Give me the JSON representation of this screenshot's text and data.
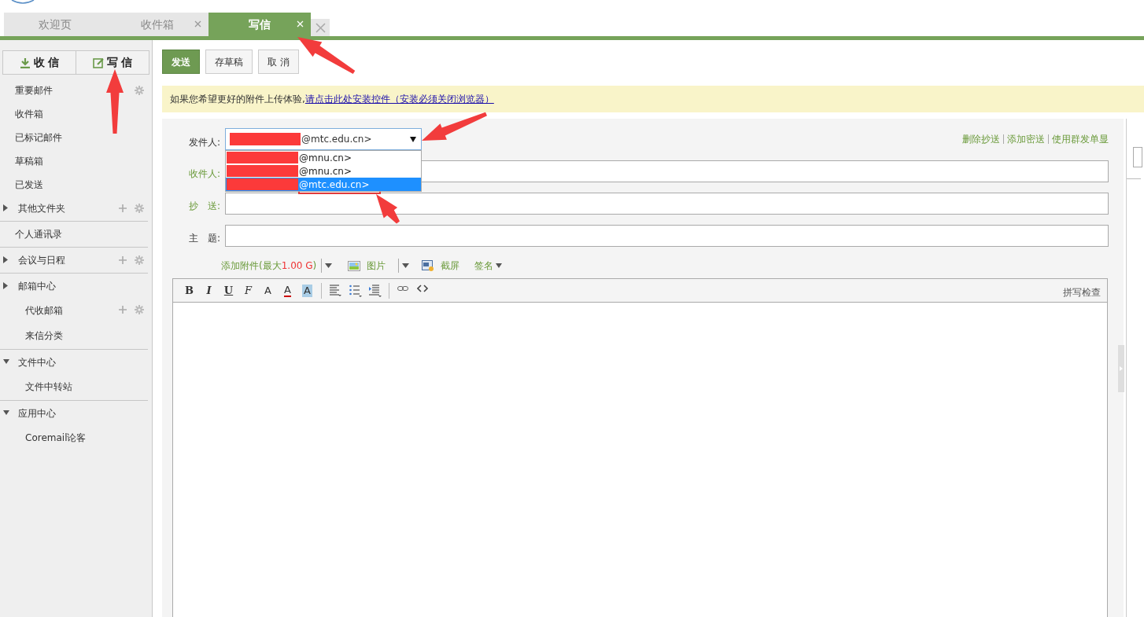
{
  "tabs": [
    {
      "label": "欢迎页",
      "selected": false,
      "closable": false
    },
    {
      "label": "收件箱",
      "selected": false,
      "closable": true
    },
    {
      "label": "写信",
      "selected": true,
      "closable": true
    }
  ],
  "sidebar": {
    "buttons": [
      {
        "label": "收 信",
        "kind": "receive"
      },
      {
        "label": "写 信",
        "kind": "compose"
      }
    ],
    "sections": [
      {
        "items": [
          {
            "label": "重要邮件",
            "kind": "folder",
            "add": false,
            "settings": true
          },
          {
            "label": "收件箱",
            "kind": "folder",
            "add": false,
            "settings": false
          },
          {
            "label": "已标记邮件",
            "kind": "folder",
            "add": false,
            "settings": false
          },
          {
            "label": "草稿箱",
            "kind": "folder",
            "add": false,
            "settings": false
          },
          {
            "label": "已发送",
            "kind": "folder",
            "add": false,
            "settings": false
          },
          {
            "label": "其他文件夹",
            "kind": "group",
            "expanded": false,
            "add": true,
            "settings": true
          }
        ]
      },
      {
        "items": [
          {
            "label": "个人通讯录",
            "kind": "folder",
            "add": false,
            "settings": false
          }
        ]
      },
      {
        "items": [
          {
            "label": "会议与日程",
            "kind": "group",
            "expanded": false,
            "add": true,
            "settings": true
          }
        ]
      },
      {
        "items": [
          {
            "label": "邮箱中心",
            "kind": "group",
            "expanded": false,
            "add": false,
            "settings": false,
            "children": [
              {
                "label": "代收邮箱",
                "add": true,
                "settings": true
              },
              {
                "label": "来信分类",
                "add": false,
                "settings": false
              }
            ]
          }
        ]
      },
      {
        "items": [
          {
            "label": "文件中心",
            "kind": "group",
            "expanded": true,
            "add": false,
            "settings": false,
            "children": [
              {
                "label": "文件中转站",
                "add": false,
                "settings": false
              }
            ]
          }
        ]
      },
      {
        "items": [
          {
            "label": "应用中心",
            "kind": "group",
            "expanded": true,
            "add": false,
            "settings": false,
            "children": [
              {
                "label": "Coremail论客",
                "add": false,
                "settings": false
              }
            ]
          }
        ]
      }
    ]
  },
  "toolbar": [
    {
      "label": "发送",
      "kind": "primary"
    },
    {
      "label": "存草稿",
      "kind": "normal"
    },
    {
      "label": "取 消",
      "kind": "normal"
    }
  ],
  "notice": {
    "text": "如果您希望更好的附件上传体验,",
    "link": "请点击此处安装控件（安装必须关闭浏览器）"
  },
  "compose": {
    "sender": {
      "label": "发件人:",
      "value": "@mtc.edu.cn>",
      "redacted": true,
      "options": [
        {
          "text": "@mnu.cn>",
          "selected": false,
          "redacted": true
        },
        {
          "text": "@mnu.cn>",
          "selected": false,
          "redacted": true
        },
        {
          "text": "@mtc.edu.cn>",
          "selected": true,
          "redacted": true
        }
      ]
    },
    "links": [
      "删除抄送",
      "添加密送",
      "使用群发单显"
    ],
    "fields": [
      {
        "label": "收件人:",
        "link": true
      },
      {
        "label": "抄　送:",
        "link": true
      },
      {
        "label": "主　题:",
        "link": false
      }
    ],
    "attach": {
      "label": "添加附件(最大",
      "size": "1.00 G",
      "end": ")",
      "picture": "图片",
      "screenshot": "截屏",
      "signature": "签名"
    },
    "editor_tools": [
      {
        "kind": "bold",
        "label": "B"
      },
      {
        "kind": "italic",
        "label": "I"
      },
      {
        "kind": "underline",
        "label": "U"
      },
      {
        "kind": "font",
        "label": "F"
      },
      {
        "kind": "size",
        "label": "A"
      },
      {
        "kind": "color",
        "label": "A"
      },
      {
        "kind": "highlight",
        "label": "A"
      },
      {
        "kind": "align"
      },
      {
        "kind": "list"
      },
      {
        "kind": "indent"
      },
      {
        "kind": "link"
      },
      {
        "kind": "source"
      }
    ],
    "spellcheck": "拼写检查"
  }
}
